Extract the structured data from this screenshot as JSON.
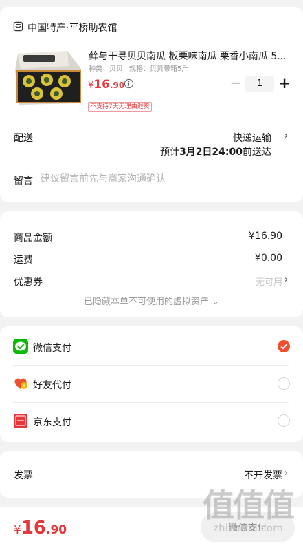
{
  "shop": {
    "name": "中国特产·平桥助农馆",
    "icon": "shop-icon"
  },
  "product": {
    "title": "藓与干寻贝贝南瓜 板栗味南瓜 栗香小南瓜 5...",
    "spec_type_label": "种类：贝贝",
    "spec_size_label": "规格：贝贝带箱5斤",
    "price_currency": "¥",
    "price_int": "16",
    "price_dec": ".90",
    "quantity": "1",
    "minus_label": "−",
    "plus_label": "+",
    "tag_no_return": "不支持7天无理由退货"
  },
  "delivery": {
    "label": "配送",
    "method": "快递运输",
    "eta_prefix": "预计",
    "eta_time": "3月2日24:00",
    "eta_suffix": "前送达"
  },
  "remark": {
    "label": "留言",
    "placeholder": "建议留言前先与商家沟通确认"
  },
  "amounts": {
    "goods_label": "商品金额",
    "goods_value": "¥16.90",
    "shipping_label": "运费",
    "shipping_value": "¥0.00",
    "coupon_label": "优惠券",
    "coupon_value": "无可用",
    "hidden_assets": "已隐藏本单不可使用的虚拟资产 ⌄"
  },
  "payment": {
    "options": [
      {
        "label": "微信支付",
        "icon": "wechat-pay-icon",
        "selected": true
      },
      {
        "label": "好友代付",
        "icon": "friend-pay-icon",
        "selected": false
      },
      {
        "label": "京东支付",
        "icon": "jd-pay-icon",
        "selected": false
      }
    ]
  },
  "invoice": {
    "label": "发票",
    "value": "不开发票"
  },
  "footer": {
    "total_currency": "¥",
    "total_int": "16",
    "total_dec": ".90",
    "pay_button": "微信支付"
  },
  "watermark": {
    "big": "值值值",
    "small": "zhizhizhi.com"
  },
  "colors": {
    "accent": "#e4393c",
    "wechat_green": "#09bb07",
    "radio_checked": "#f0502f",
    "background": "#f2f2f2"
  }
}
